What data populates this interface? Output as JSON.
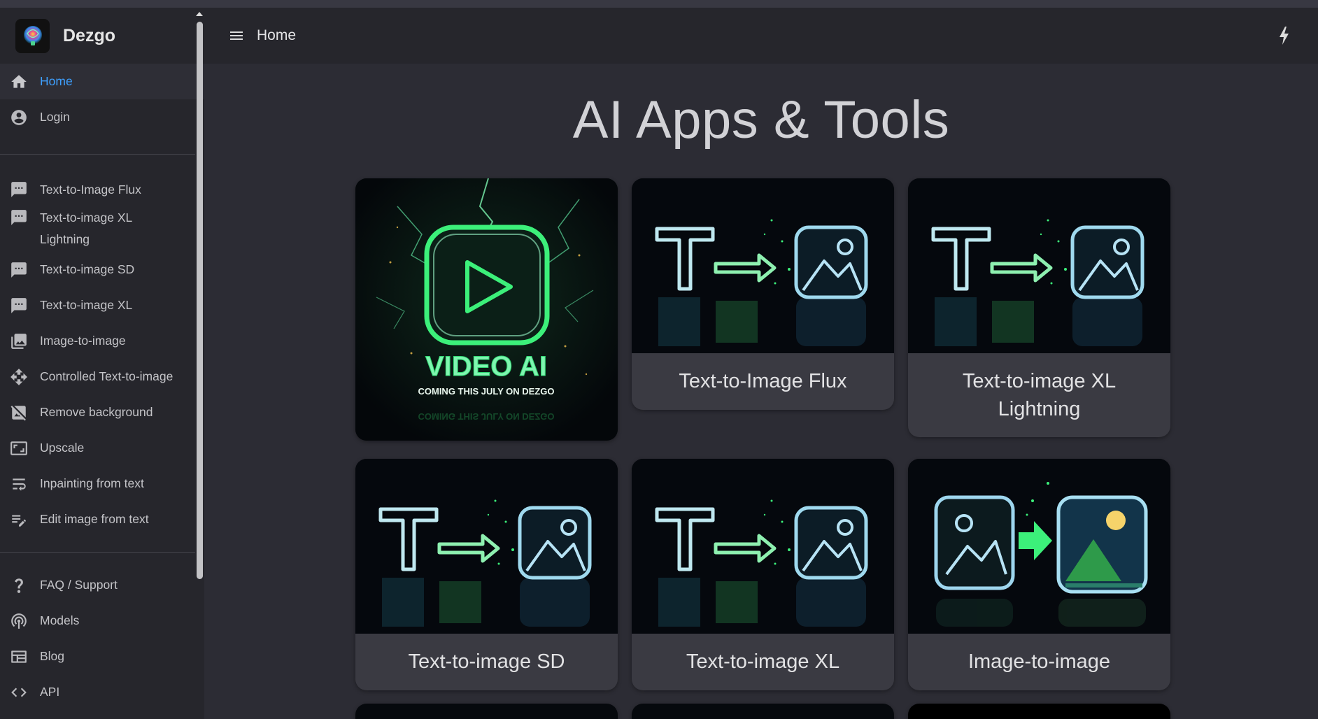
{
  "app": {
    "name": "Dezgo"
  },
  "header": {
    "title": "Home"
  },
  "page": {
    "title": "AI Apps & Tools"
  },
  "sidebar": {
    "primary": [
      {
        "label": "Home",
        "icon": "home-icon",
        "active": true
      },
      {
        "label": "Login",
        "icon": "account-circle-icon"
      }
    ],
    "tools": [
      {
        "label": "Text-to-Image Flux",
        "icon": "chat-bubble-icon"
      },
      {
        "label": "Text-to-image XL Lightning",
        "icon": "chat-bubble-icon"
      },
      {
        "label": "Text-to-image SD",
        "icon": "chat-bubble-icon"
      },
      {
        "label": "Text-to-image XL",
        "icon": "chat-bubble-icon"
      },
      {
        "label": "Image-to-image",
        "icon": "image-icon"
      },
      {
        "label": "Controlled Text-to-image",
        "icon": "move-arrows-icon"
      },
      {
        "label": "Remove background",
        "icon": "hide-image-icon"
      },
      {
        "label": "Upscale",
        "icon": "aspect-ratio-icon"
      },
      {
        "label": "Inpainting from text",
        "icon": "wrap-text-icon"
      },
      {
        "label": "Edit image from text",
        "icon": "edit-note-icon"
      }
    ],
    "footer": [
      {
        "label": "FAQ / Support",
        "icon": "question-icon"
      },
      {
        "label": "Models",
        "icon": "model-icon"
      },
      {
        "label": "Blog",
        "icon": "blog-icon"
      },
      {
        "label": "API",
        "icon": "code-icon"
      }
    ]
  },
  "cards": [
    {
      "label": "",
      "image": "video-ai-promo",
      "image_text": "VIDEO AI",
      "image_subtext": "COMING THIS JULY ON DEZGO"
    },
    {
      "label": "Text-to-Image Flux",
      "image": "text-to-image-art"
    },
    {
      "label": "Text-to-image XL Lightning",
      "image": "text-to-image-art"
    },
    {
      "label": "Text-to-image SD",
      "image": "text-to-image-art"
    },
    {
      "label": "Text-to-image XL",
      "image": "text-to-image-art"
    },
    {
      "label": "Image-to-image",
      "image": "image-to-image-art"
    }
  ],
  "colors": {
    "accent": "#3ea0ff",
    "background": "#2c2c34",
    "panel": "#26262c",
    "card": "#3a3a42",
    "neon": "#3cf07a"
  }
}
